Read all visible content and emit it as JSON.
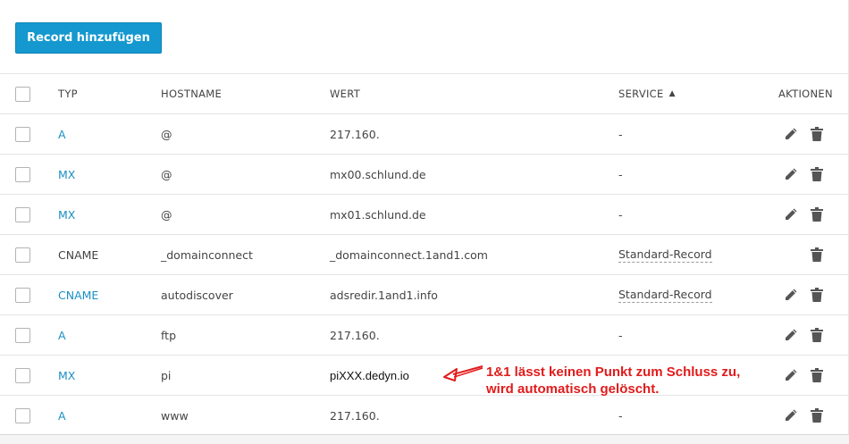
{
  "toolbar": {
    "add_record_label": "Record hinzufügen"
  },
  "table": {
    "headers": {
      "typ": "TYP",
      "hostname": "HOSTNAME",
      "wert": "WERT",
      "service": "SERVICE",
      "service_sort": "▲",
      "aktionen": "AKTIONEN"
    },
    "rows": [
      {
        "type": "A",
        "host": "@",
        "value": "217.160.",
        "service": "-"
      },
      {
        "type": "MX",
        "host": "@",
        "value": "mx00.schlund.de",
        "service": "-"
      },
      {
        "type": "MX",
        "host": "@",
        "value": "mx01.schlund.de",
        "service": "-"
      },
      {
        "type": "CNAME",
        "host": "_domainconnect",
        "value": "_domainconnect.1and1.com",
        "service": "Standard-Record"
      },
      {
        "type": "CNAME",
        "host": "autodiscover",
        "value": "adsredir.1and1.info",
        "service": "Standard-Record"
      },
      {
        "type": "A",
        "host": "ftp",
        "value": "217.160.",
        "service": "-"
      },
      {
        "type": "MX",
        "host": "pi",
        "value": "piXXX.dedyn.io",
        "service": ""
      },
      {
        "type": "A",
        "host": "www",
        "value": "217.160.",
        "service": "-"
      }
    ]
  },
  "annotation": {
    "line1": "1&1 lässt keinen Punkt zum Schluss zu,",
    "line2": "wird automatisch gelöscht.",
    "color": "#e11b1b"
  },
  "colors": {
    "accent": "#1598cf",
    "link": "#1a8fc4"
  },
  "icons": {
    "edit": "pencil-icon",
    "delete": "trash-icon"
  }
}
